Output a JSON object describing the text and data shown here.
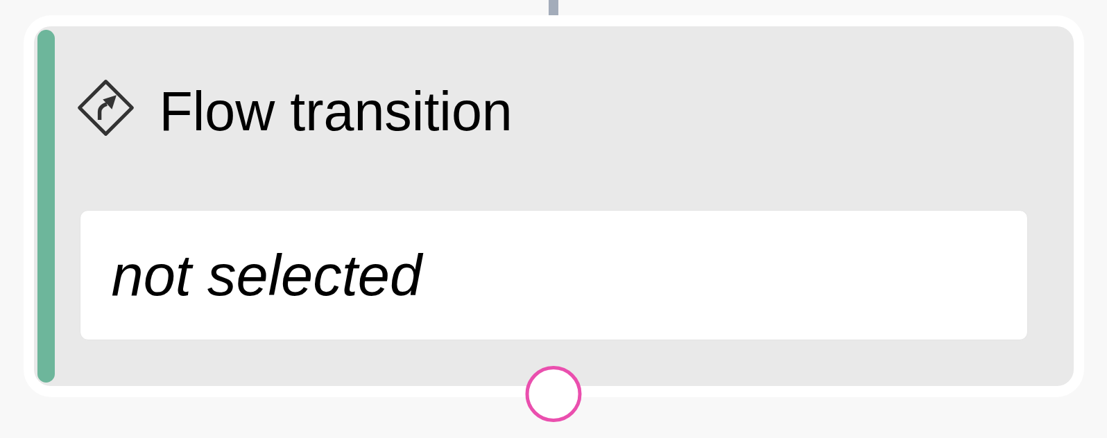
{
  "node": {
    "title": "Flow transition",
    "selection": "not selected"
  }
}
